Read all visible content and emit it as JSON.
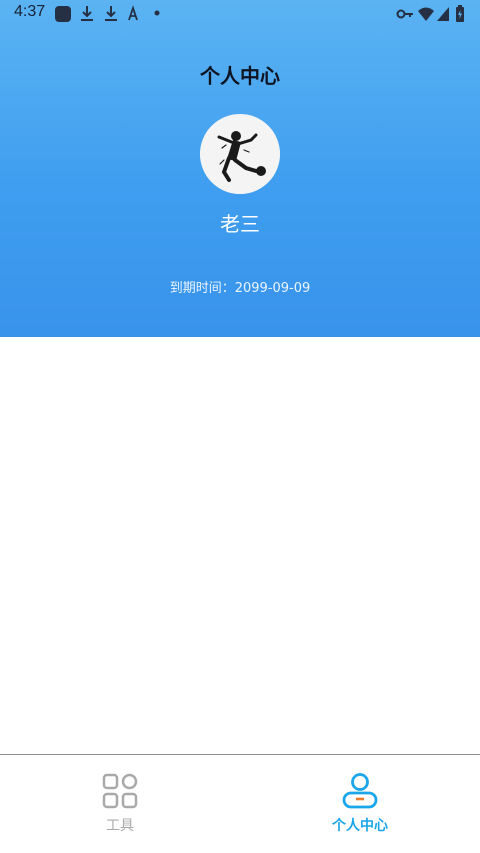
{
  "status_bar": {
    "time": "4:37",
    "left_icons": [
      "app-square-icon",
      "download-icon",
      "download-icon",
      "font-a-icon",
      "dot-icon"
    ],
    "right_icons": [
      "vpn-key-icon",
      "wifi-icon",
      "signal-icon",
      "battery-icon"
    ]
  },
  "header": {
    "title": "个人中心",
    "username": "老三",
    "expiry_label": "到期时间：",
    "expiry_value": "2099-09-09",
    "gradient_colors": [
      "#5bb3f2",
      "#3893ea"
    ]
  },
  "tabbar": {
    "tabs": [
      {
        "label": "工具",
        "icon": "grid-icon",
        "active": false
      },
      {
        "label": "个人中心",
        "icon": "user-icon",
        "active": true
      }
    ],
    "active_color": "#1aa6e8",
    "inactive_color": "#a9a9a9"
  }
}
